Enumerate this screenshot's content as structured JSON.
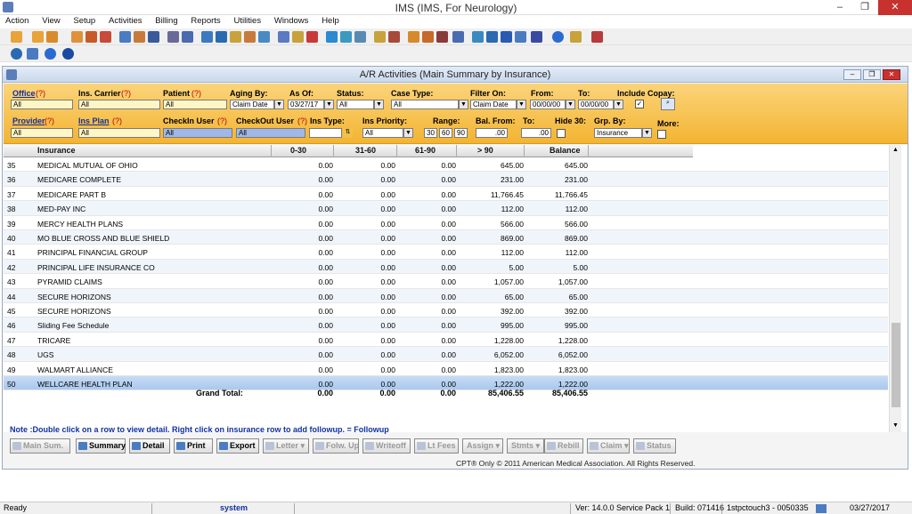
{
  "window": {
    "title": "IMS (IMS, For Neurology)"
  },
  "menu": [
    "Action",
    "View",
    "Setup",
    "Activities",
    "Billing",
    "Reports",
    "Utilities",
    "Windows",
    "Help"
  ],
  "mdi": {
    "title": "A/R Activities  (Main Summary by Insurance)"
  },
  "filters": {
    "office_label": "Office",
    "office_value": "All",
    "ins_carrier_label": "Ins. Carrier",
    "ins_carrier_value": "All",
    "patient_label": "Patient",
    "patient_value": "All",
    "aging_by_label": "Aging By:",
    "aging_by_value": "Claim Date",
    "as_of_label": "As Of:",
    "as_of_value": "03/27/17",
    "status_label": "Status:",
    "status_value": "All",
    "case_type_label": "Case Type:",
    "case_type_value": "All",
    "filter_on_label": "Filter On:",
    "filter_on_value": "Claim Date",
    "from_label": "From:",
    "from_value": "00/00/00",
    "to_label": "To:",
    "to_value": "00/00/00",
    "include_copay_label": "Include Copay:",
    "provider_label": "Provider",
    "provider_value": "All",
    "ins_plan_label": "Ins Plan",
    "ins_plan_value": "All",
    "checkin_label": "CheckIn User",
    "checkin_value": "All",
    "checkout_label": "CheckOut User",
    "checkout_value": "All",
    "ins_type_label": "Ins Type:",
    "ins_type_value": "",
    "ins_priority_label": "Ins Priority:",
    "ins_priority_value": "All",
    "range_label": "Range:",
    "range_1": "30",
    "range_2": "60",
    "range_3": "90",
    "bal_from_label": "Bal. From:",
    "bal_from_value": ".00",
    "bal_to_label": "To:",
    "bal_to_value": ".00",
    "hide30_label": "Hide 30:",
    "grp_by_label": "Grp. By:",
    "grp_by_value": "Insurance",
    "more_label": "More:",
    "q": "(?)"
  },
  "table": {
    "headers": [
      "Insurance",
      "0-30",
      "31-60",
      "61-90",
      "> 90",
      "Balance"
    ],
    "rows": [
      {
        "id": "35",
        "name": "MEDICAL MUTUAL OF OHIO",
        "c1": "0.00",
        "c2": "0.00",
        "c3": "0.00",
        "c4": "645.00",
        "bal": "645.00"
      },
      {
        "id": "36",
        "name": "MEDICARE COMPLETE",
        "c1": "0.00",
        "c2": "0.00",
        "c3": "0.00",
        "c4": "231.00",
        "bal": "231.00"
      },
      {
        "id": "37",
        "name": "MEDICARE PART B",
        "c1": "0.00",
        "c2": "0.00",
        "c3": "0.00",
        "c4": "11,766.45",
        "bal": "11,766.45"
      },
      {
        "id": "38",
        "name": "MED-PAY INC",
        "c1": "0.00",
        "c2": "0.00",
        "c3": "0.00",
        "c4": "112.00",
        "bal": "112.00"
      },
      {
        "id": "39",
        "name": "MERCY HEALTH PLANS",
        "c1": "0.00",
        "c2": "0.00",
        "c3": "0.00",
        "c4": "566.00",
        "bal": "566.00"
      },
      {
        "id": "40",
        "name": "MO BLUE CROSS AND BLUE SHIELD",
        "c1": "0.00",
        "c2": "0.00",
        "c3": "0.00",
        "c4": "869.00",
        "bal": "869.00"
      },
      {
        "id": "41",
        "name": "PRINCIPAL FINANCIAL GROUP",
        "c1": "0.00",
        "c2": "0.00",
        "c3": "0.00",
        "c4": "112.00",
        "bal": "112.00"
      },
      {
        "id": "42",
        "name": "PRINCIPAL LIFE INSURANCE CO",
        "c1": "0.00",
        "c2": "0.00",
        "c3": "0.00",
        "c4": "5.00",
        "bal": "5.00"
      },
      {
        "id": "43",
        "name": "PYRAMID CLAIMS",
        "c1": "0.00",
        "c2": "0.00",
        "c3": "0.00",
        "c4": "1,057.00",
        "bal": "1,057.00"
      },
      {
        "id": "44",
        "name": "SECURE HORIZONS",
        "c1": "0.00",
        "c2": "0.00",
        "c3": "0.00",
        "c4": "65.00",
        "bal": "65.00"
      },
      {
        "id": "45",
        "name": "SECURE HORIZONS",
        "c1": "0.00",
        "c2": "0.00",
        "c3": "0.00",
        "c4": "392.00",
        "bal": "392.00"
      },
      {
        "id": "46",
        "name": "Sliding Fee Schedule",
        "c1": "0.00",
        "c2": "0.00",
        "c3": "0.00",
        "c4": "995.00",
        "bal": "995.00"
      },
      {
        "id": "47",
        "name": "TRICARE",
        "c1": "0.00",
        "c2": "0.00",
        "c3": "0.00",
        "c4": "1,228.00",
        "bal": "1,228.00"
      },
      {
        "id": "48",
        "name": "UGS",
        "c1": "0.00",
        "c2": "0.00",
        "c3": "0.00",
        "c4": "6,052.00",
        "bal": "6,052.00"
      },
      {
        "id": "49",
        "name": "WALMART ALLIANCE",
        "c1": "0.00",
        "c2": "0.00",
        "c3": "0.00",
        "c4": "1,823.00",
        "bal": "1,823.00"
      },
      {
        "id": "50",
        "name": "WELLCARE HEALTH PLAN",
        "c1": "0.00",
        "c2": "0.00",
        "c3": "0.00",
        "c4": "1,222.00",
        "bal": "1,222.00"
      }
    ],
    "grand_total_label": "Grand Total:",
    "totals": {
      "c1": "0.00",
      "c2": "0.00",
      "c3": "0.00",
      "c4": "85,406.55",
      "bal": "85,406.55"
    }
  },
  "note": "Note :Double click on a row to view detail. Right click on insurance row to add followup.  = Followup",
  "buttons": {
    "main_sum": "Main Sum.",
    "summary": "Summary",
    "detail": "Detail",
    "print": "Print",
    "export": "Export",
    "letter": "Letter",
    "folw_up": "Folw. Up",
    "writeoff": "Writeoff",
    "lt_fees": "Lt Fees",
    "assign": "Assign",
    "stmts": "Stmts",
    "rebill": "Rebill",
    "claim": "Claim",
    "status": "Status"
  },
  "copyright": "CPT® Only © 2011 American Medical Association. All Rights Reserved.",
  "statusbar": {
    "ready": "Ready",
    "user": "system",
    "version": "Ver: 14.0.0 Service Pack 1",
    "build": "Build: 071416",
    "host": "1stpctouch3 - 0050335",
    "date": "03/27/2017"
  }
}
